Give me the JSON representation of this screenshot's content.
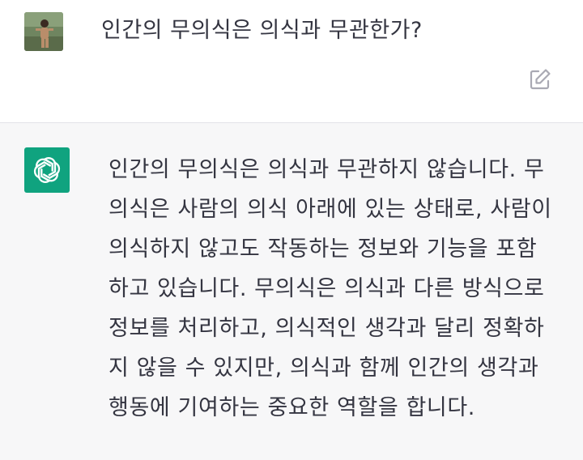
{
  "user": {
    "avatar_icon": "user-photo-avatar",
    "message": "인간의 무의식은 의식과 무관한가?",
    "edit_icon": "edit-icon"
  },
  "assistant": {
    "logo_icon": "openai-logo-icon",
    "accent_color": "#10a37f",
    "lines": [
      "인간의 무의식은 의식과 무관하지 않습니다. 무",
      "의식은 사람의 의식 아래에 있는 상태로, 사람이",
      "의식하지 않고도 작동하는 정보와 기능을 포함",
      "하고 있습니다. 무의식은 의식과 다른 방식으로",
      "정보를 처리하고, 의식적인 생각과 달리 정확하",
      "지 않을 수 있지만, 의식과 함께 인간의 생각과",
      "행동에 기여하는 중요한 역할을 합니다."
    ]
  }
}
